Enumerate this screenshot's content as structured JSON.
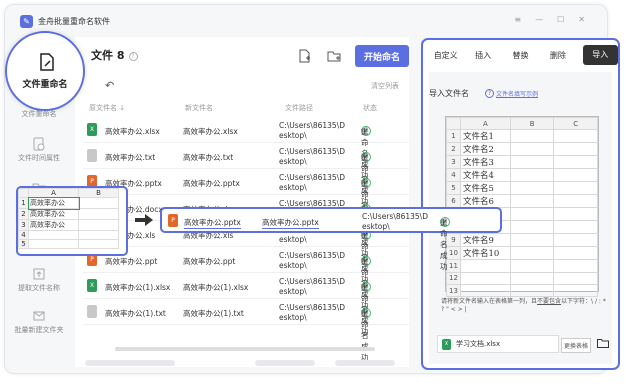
{
  "app": {
    "title": "金舟批量重命名软件"
  },
  "sidebar": {
    "items": [
      {
        "label": "文件重命名"
      },
      {
        "label": "文件时间属性"
      },
      {
        "label": "导出文件名"
      },
      {
        "label": "提取文件名称"
      },
      {
        "label": "批量新建文件夹"
      }
    ]
  },
  "highlight_circle": {
    "label": "文件重命名"
  },
  "header": {
    "title": "文件",
    "count": "8",
    "start_label": "开始命名",
    "clear_label": "清空列表"
  },
  "columns": {
    "orig": "原文件名",
    "new": "新文件名",
    "path": "文件路径",
    "status": "状态"
  },
  "rows": [
    {
      "orig": "高效率办公.xlsx",
      "new": "高效率办公.xlsx",
      "path1": "C:\\Users\\86135\\D",
      "path2": "esktop\\",
      "status": "重命名成功",
      "color": "#2e9b5a",
      "ext": "X"
    },
    {
      "orig": "高效率办公.txt",
      "new": "高效率办公.txt",
      "path1": "C:\\Users\\86135\\D",
      "path2": "esktop\\",
      "status": "重命名成功",
      "color": "#c8c8c8",
      "ext": ""
    },
    {
      "orig": "高效率办公.pptx",
      "new": "高效率办公.pptx",
      "path1": "C:\\Users\\86135\\D",
      "path2": "esktop\\",
      "status": "重命名成功",
      "color": "#e3672a",
      "ext": "P"
    },
    {
      "orig": "高效率办公.docx",
      "new": "高效率办公.docx",
      "path1": "C:\\Users\\86135\\D",
      "path2": "esktop\\",
      "status": "重命名成功",
      "color": "#3b6fd8",
      "ext": "W"
    },
    {
      "orig": "高效率办公.xls",
      "new": "高效率办公.xls",
      "path1": "C:\\Users\\86135\\D",
      "path2": "esktop\\",
      "status": "重命名成功",
      "color": "#2e9b5a",
      "ext": "X"
    },
    {
      "orig": "高效率办公.ppt",
      "new": "高效率办公.ppt",
      "path1": "C:\\Users\\86135\\D",
      "path2": "esktop\\",
      "status": "重命名成功",
      "color": "#e3672a",
      "ext": "P"
    },
    {
      "orig": "高效率办公(1).xlsx",
      "new": "高效率办公(1).xlsx",
      "path1": "C:\\Users\\86135\\D",
      "path2": "esktop\\",
      "status": "重命名成功",
      "color": "#2e9b5a",
      "ext": "X"
    },
    {
      "orig": "高效率办公(1).txt",
      "new": "高效率办公(1).txt",
      "path1": "C:\\Users\\86135\\D",
      "path2": "esktop\\",
      "status": "重命名成功",
      "color": "#c8c8c8",
      "ext": ""
    }
  ],
  "strip": {
    "orig": "高效率办公.pptx",
    "new": "高效率办公.pptx",
    "path1": "C:\\Users\\86135\\D",
    "path2": "esktop\\",
    "status": "重命名成功"
  },
  "popup": {
    "col_a": "A",
    "col_b": "B",
    "col_c": "C",
    "rows": [
      "1",
      "2",
      "3",
      "4",
      "5"
    ],
    "values": [
      "高效率办公",
      "高效率办公",
      "高效率办公",
      "",
      ""
    ]
  },
  "right_panel": {
    "tabs": [
      "自定义",
      "插入",
      "替换",
      "删除",
      "导入"
    ],
    "import_title": "导入文件名",
    "help_link": "文件名填写示例",
    "sheet": {
      "cols": [
        "A",
        "B",
        "C"
      ],
      "rows": [
        "1",
        "2",
        "3",
        "4",
        "5",
        "6",
        "7",
        "8",
        "9",
        "10",
        "11",
        "12",
        "13"
      ],
      "values": [
        "文件名1",
        "文件名2",
        "文件名3",
        "文件名4",
        "文件名5",
        "文件名6",
        "文件名7",
        "文件名8",
        "文件名9",
        "文件名10",
        "",
        "",
        ""
      ]
    },
    "note_a": "请将新文件名输入在表格第一列，且",
    "note_b": "不要包含",
    "note_c": "以下字符：\\ / : * ? \" < > |",
    "file_name": "学习文档.xlsx",
    "change_label": "更换表格"
  }
}
